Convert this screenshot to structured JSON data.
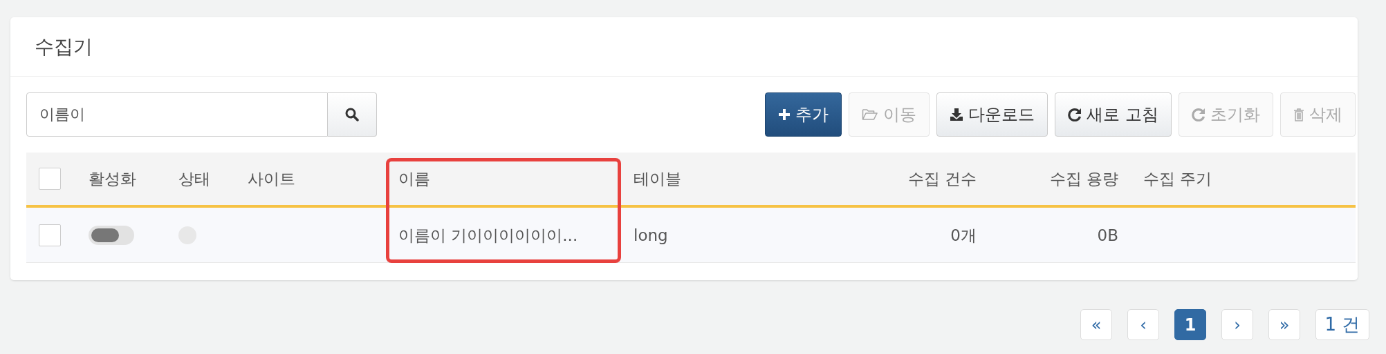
{
  "panel": {
    "title": "수집기"
  },
  "search": {
    "value": "이름이"
  },
  "toolbar": [
    {
      "kind": "add",
      "label": "추가",
      "primary": true,
      "disabled": false
    },
    {
      "kind": "move",
      "label": "이동",
      "primary": false,
      "disabled": true
    },
    {
      "kind": "download",
      "label": "다운로드",
      "primary": false,
      "disabled": false
    },
    {
      "kind": "refresh",
      "label": "새로 고침",
      "primary": false,
      "disabled": false
    },
    {
      "kind": "reset",
      "label": "초기화",
      "primary": false,
      "disabled": true
    },
    {
      "kind": "delete",
      "label": "삭제",
      "primary": false,
      "disabled": true
    }
  ],
  "table": {
    "header_checked": false,
    "columns": [
      {
        "kind": "toggle",
        "label": "활성화",
        "highlighted": false
      },
      {
        "kind": "status",
        "label": "상태",
        "highlighted": false
      },
      {
        "kind": "blank",
        "label": "사이트",
        "highlighted": false
      },
      {
        "kind": "text",
        "label": "이름",
        "highlighted": true
      },
      {
        "kind": "text",
        "label": "테이블",
        "highlighted": false
      },
      {
        "kind": "number",
        "label": "수집 건수",
        "highlighted": false
      },
      {
        "kind": "number",
        "label": "수집 용량",
        "highlighted": false
      },
      {
        "kind": "blank",
        "label": "수집 주기",
        "highlighted": false
      }
    ],
    "rows": [
      {
        "checked": false,
        "enabled": false,
        "active": false,
        "cells": [
          "",
          "",
          "",
          "이름이 기이이이이이이...",
          "long",
          "0개",
          "0B",
          ""
        ]
      }
    ]
  },
  "pagination": {
    "items": [
      {
        "label": "«",
        "selected": false
      },
      {
        "label": "‹",
        "selected": false
      },
      {
        "label": "1",
        "selected": true
      },
      {
        "label": "›",
        "selected": false
      },
      {
        "label": "»",
        "selected": false
      }
    ],
    "total": "1 건"
  }
}
